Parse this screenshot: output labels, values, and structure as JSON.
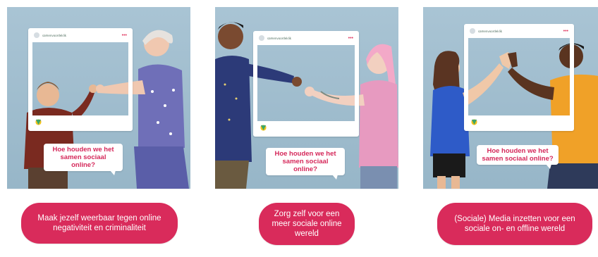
{
  "cards": [
    {
      "frame_user": "samenvoordeklik",
      "frame_dots": "•••",
      "bubble_text": "Hoe houden we het samen sociaal online?",
      "cta_label": "Maak jezelf weerbaar tegen online negativiteit en criminaliteit"
    },
    {
      "frame_user": "samenvoordeklik",
      "frame_dots": "•••",
      "bubble_text": "Hoe houden we het samen sociaal online?",
      "cta_label": "Zorg zelf voor een meer sociale online wereld"
    },
    {
      "frame_user": "samenvoordeklik",
      "frame_dots": "•••",
      "bubble_text": "Hoe houden we het samen sociaal online?",
      "cta_label": "(Sociale) Media inzetten voor een sociale on- en offline wereld"
    }
  ],
  "reaction_icons": [
    "heart-icon",
    "emoji-icon",
    "send-icon"
  ],
  "colors": {
    "accent": "#d92b5b",
    "photo_background": "#a9c4d4",
    "bubble_text": "#d5285a",
    "heart": "#e0365f",
    "emoji": "#f2c31b",
    "send": "#3aa66a"
  }
}
